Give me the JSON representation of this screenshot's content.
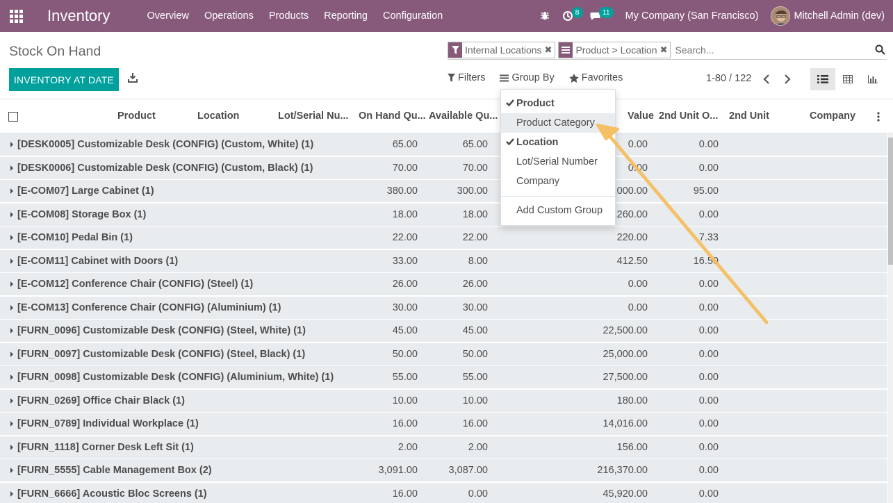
{
  "navbar": {
    "app_name": "Inventory",
    "menu": [
      "Overview",
      "Operations",
      "Products",
      "Reporting",
      "Configuration"
    ],
    "activity_count": "8",
    "messages_count": "11",
    "company": "My Company (San Francisco)",
    "user": "Mitchell Admin (dev)"
  },
  "control_panel": {
    "title": "Stock On Hand",
    "primary_button": "INVENTORY AT DATE",
    "facets": [
      {
        "icon": "filter-icon",
        "value": "Internal Locations"
      },
      {
        "icon": "group-by-icon",
        "value": "Product > Location"
      }
    ],
    "search_placeholder": "Search...",
    "filters_label": "Filters",
    "group_by_label": "Group By",
    "favorites_label": "Favorites",
    "pager": "1-80 / 122"
  },
  "group_by_menu": {
    "items": [
      {
        "label": "Product",
        "checked": true
      },
      {
        "label": "Product Category",
        "checked": false
      },
      {
        "label": "Location",
        "checked": true
      },
      {
        "label": "Lot/Serial Number",
        "checked": false
      },
      {
        "label": "Company",
        "checked": false
      }
    ],
    "add_custom": "Add Custom Group"
  },
  "table": {
    "columns": [
      "Product",
      "Location",
      "Lot/Serial Nu...",
      "On Hand Qu...",
      "Available Qu...",
      "Value",
      "2nd Unit O...",
      "2nd Unit",
      "Company"
    ],
    "rows": [
      {
        "name": "[DESK0005] Customizable Desk (CONFIG) (Custom, White) (1)",
        "on_hand": "65.00",
        "available": "65.00",
        "value": "0.00",
        "unit2": "0.00"
      },
      {
        "name": "[DESK0006] Customizable Desk (CONFIG) (Custom, Black) (1)",
        "on_hand": "70.00",
        "available": "70.00",
        "value": "0.00",
        "unit2": "0.00"
      },
      {
        "name": "[E-COM07] Large Cabinet (1)",
        "on_hand": "380.00",
        "available": "300.00",
        "value": "4,000.00",
        "unit2": "95.00"
      },
      {
        "name": "[E-COM08] Storage Box (1)",
        "on_hand": "18.00",
        "available": "18.00",
        "value": "1,260.00",
        "unit2": "0.00"
      },
      {
        "name": "[E-COM10] Pedal Bin (1)",
        "on_hand": "22.00",
        "available": "22.00",
        "value": "220.00",
        "unit2": "7.33"
      },
      {
        "name": "[E-COM11] Cabinet with Doors (1)",
        "on_hand": "33.00",
        "available": "8.00",
        "value": "412.50",
        "unit2": "16.50"
      },
      {
        "name": "[E-COM12] Conference Chair (CONFIG) (Steel) (1)",
        "on_hand": "26.00",
        "available": "26.00",
        "value": "0.00",
        "unit2": "0.00"
      },
      {
        "name": "[E-COM13] Conference Chair (CONFIG) (Aluminium) (1)",
        "on_hand": "30.00",
        "available": "30.00",
        "value": "0.00",
        "unit2": "0.00"
      },
      {
        "name": "[FURN_0096] Customizable Desk (CONFIG) (Steel, White) (1)",
        "on_hand": "45.00",
        "available": "45.00",
        "value": "22,500.00",
        "unit2": "0.00"
      },
      {
        "name": "[FURN_0097] Customizable Desk (CONFIG) (Steel, Black) (1)",
        "on_hand": "50.00",
        "available": "50.00",
        "value": "25,000.00",
        "unit2": "0.00"
      },
      {
        "name": "[FURN_0098] Customizable Desk (CONFIG) (Aluminium, White) (1)",
        "on_hand": "55.00",
        "available": "55.00",
        "value": "27,500.00",
        "unit2": "0.00"
      },
      {
        "name": "[FURN_0269] Office Chair Black (1)",
        "on_hand": "10.00",
        "available": "10.00",
        "value": "180.00",
        "unit2": "0.00"
      },
      {
        "name": "[FURN_0789] Individual Workplace (1)",
        "on_hand": "16.00",
        "available": "16.00",
        "value": "14,016.00",
        "unit2": "0.00"
      },
      {
        "name": "[FURN_1118] Corner Desk Left Sit (1)",
        "on_hand": "2.00",
        "available": "2.00",
        "value": "156.00",
        "unit2": "0.00"
      },
      {
        "name": "[FURN_5555] Cable Management Box (2)",
        "on_hand": "3,091.00",
        "available": "3,087.00",
        "value": "216,370.00",
        "unit2": "0.00"
      },
      {
        "name": "[FURN_6666] Acoustic Bloc Screens (1)",
        "on_hand": "16.00",
        "available": "0.00",
        "value": "45,920.00",
        "unit2": "0.00"
      }
    ]
  },
  "colors": {
    "brand": "#875a7b",
    "primary": "#00a09d",
    "annotation_arrow": "#f5bd5e"
  }
}
